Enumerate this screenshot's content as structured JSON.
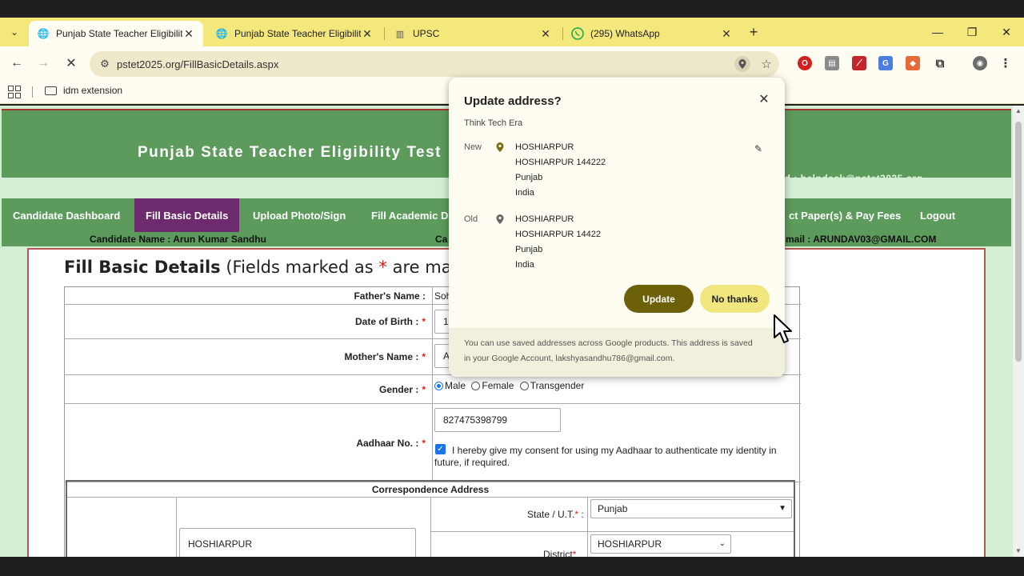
{
  "browser": {
    "tabs": [
      {
        "title": "Punjab State Teacher Eligibility",
        "active": true
      },
      {
        "title": "Punjab State Teacher Eligibility",
        "active": false
      },
      {
        "title": "UPSC",
        "active": false
      },
      {
        "title": "(295) WhatsApp",
        "active": false
      }
    ],
    "url": "pstet2025.org/FillBasicDetails.aspx",
    "bookmark_folder": "idm extension"
  },
  "site": {
    "title": "Punjab State Teacher Eligibility Test",
    "mail_partial": "ailid : helpdesk@pstet2025.org",
    "menu": [
      {
        "label": "Candidate Dashboard"
      },
      {
        "label": "Fill Basic Details"
      },
      {
        "label": "Upload Photo/Sign"
      },
      {
        "label": "Fill Academic D"
      },
      {
        "label": "ct Paper(s) & Pay Fees"
      },
      {
        "label": "Logout"
      }
    ],
    "info": {
      "candidate_name": "Candidate Name : Arun Kumar Sandhu",
      "middle_partial": "Ca",
      "email_partial": "mail : ARUNDAV03@GMAIL.COM"
    }
  },
  "form": {
    "title_bold": "Fill Basic Details",
    "title_rest_1": " (Fields marked as ",
    "title_star": "*",
    "title_rest_2": " are mandat",
    "fathers_name_label": "Father's Name :",
    "fathers_name_value": "Soh",
    "dob_label": "Date of Birth :",
    "dob_value": "12",
    "mothers_name_label": "Mother's Name :",
    "mothers_name_value": "A",
    "gender_label": "Gender :",
    "gender_options": [
      "Male",
      "Female",
      "Transgender"
    ],
    "aadhaar_label": "Aadhaar No. :",
    "aadhaar_value": "827475398799",
    "consent_text_1": "I hereby give my consent for using my Aadhaar to authenticate my identity in",
    "consent_text_2": "future, if required.",
    "req_star": "*",
    "address_heading": "Correspondence Address",
    "address_value": "HOSHIARPUR",
    "state_label": "State / U.T.",
    "state_value": "Punjab",
    "district_label": "District",
    "district_value": "HOSHIARPUR"
  },
  "popup": {
    "title": "Update address?",
    "subtitle": "Think Tech Era",
    "new_label": "New",
    "new_lines": [
      "HOSHIARPUR",
      "HOSHIARPUR 144222",
      "Punjab",
      "India"
    ],
    "old_label": "Old",
    "old_lines": [
      "HOSHIARPUR",
      "HOSHIARPUR 14422",
      "Punjab",
      "India"
    ],
    "update_label": "Update",
    "no_thanks_label": "No thanks",
    "footer_1": "You can use saved addresses across Google products. This address is saved",
    "footer_2": "in your Google Account, lakshyasandhu786@gmail.com.",
    "colors": {
      "update": "#6c6009",
      "no_thanks": "#f1e67e",
      "pin": "#7a6d10"
    }
  }
}
